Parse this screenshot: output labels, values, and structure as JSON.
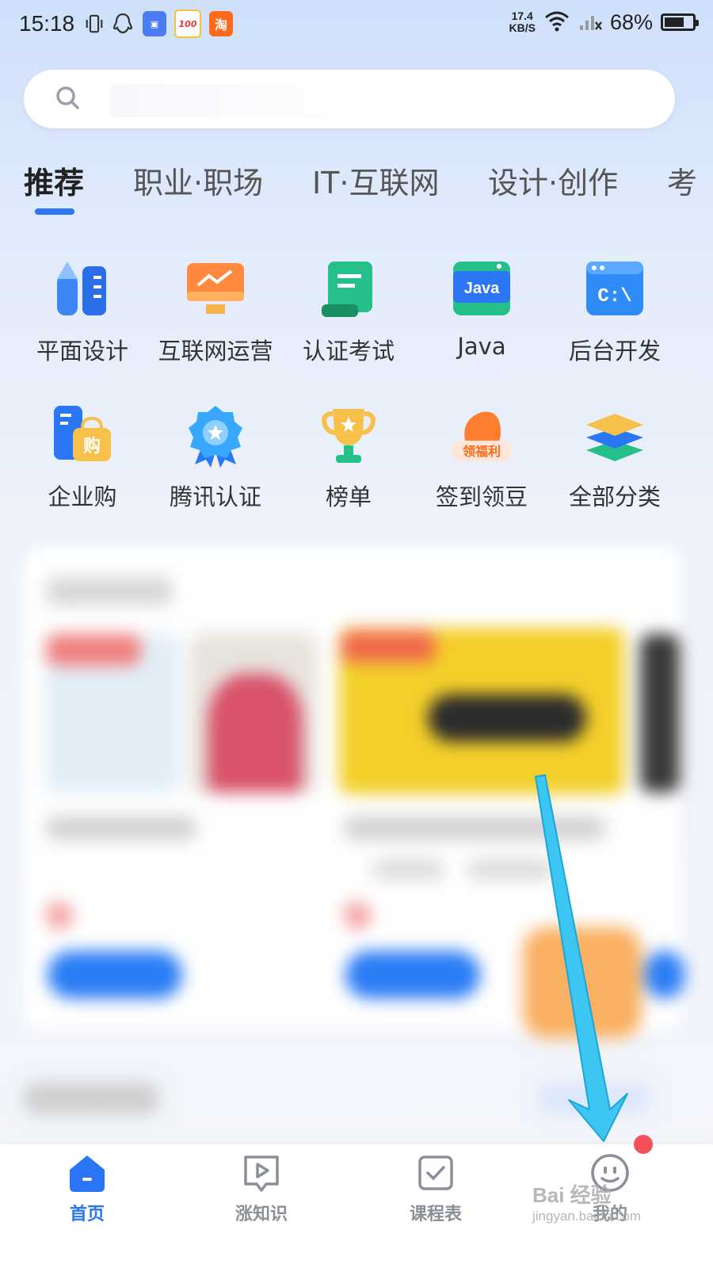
{
  "status_bar": {
    "time": "15:18",
    "net_speed_value": "17.4",
    "net_speed_unit": "KB/S",
    "battery": "68%"
  },
  "search": {
    "placeholder": ""
  },
  "tabs": [
    {
      "label": "推荐",
      "active": true
    },
    {
      "label": "职业·职场",
      "active": false
    },
    {
      "label": "IT·互联网",
      "active": false
    },
    {
      "label": "设计·创作",
      "active": false
    },
    {
      "label": "考",
      "active": false
    }
  ],
  "categories": [
    {
      "label": "平面设计",
      "icon": "pencil-ruler-icon"
    },
    {
      "label": "互联网运营",
      "icon": "monitor-chart-icon"
    },
    {
      "label": "认证考试",
      "icon": "document-scroll-icon"
    },
    {
      "label": "Java",
      "icon": "java-icon"
    },
    {
      "label": "后台开发",
      "icon": "terminal-icon"
    },
    {
      "label": "企业购",
      "icon": "shopping-bag-icon"
    },
    {
      "label": "腾讯认证",
      "icon": "badge-star-icon"
    },
    {
      "label": "榜单",
      "icon": "trophy-icon"
    },
    {
      "label": "签到领豆",
      "icon": "gift-welfare-icon"
    },
    {
      "label": "全部分类",
      "icon": "layers-icon"
    }
  ],
  "icon_texts": {
    "java": "Java",
    "terminal": "C:\\",
    "bag": "购",
    "welfare": "领福利"
  },
  "bottom_nav": [
    {
      "label": "首页",
      "icon": "home-icon",
      "active": true
    },
    {
      "label": "涨知识",
      "icon": "play-bubble-icon",
      "active": false
    },
    {
      "label": "课程表",
      "icon": "checklist-icon",
      "active": false
    },
    {
      "label": "我的",
      "icon": "smile-face-icon",
      "active": false
    }
  ],
  "watermark": {
    "line1": "Bai 经验",
    "line2": "jingyan.baidu.com"
  },
  "colors": {
    "accent": "#2a76f5",
    "badge": "#f2505c",
    "arrow": "#3ec6f2"
  }
}
